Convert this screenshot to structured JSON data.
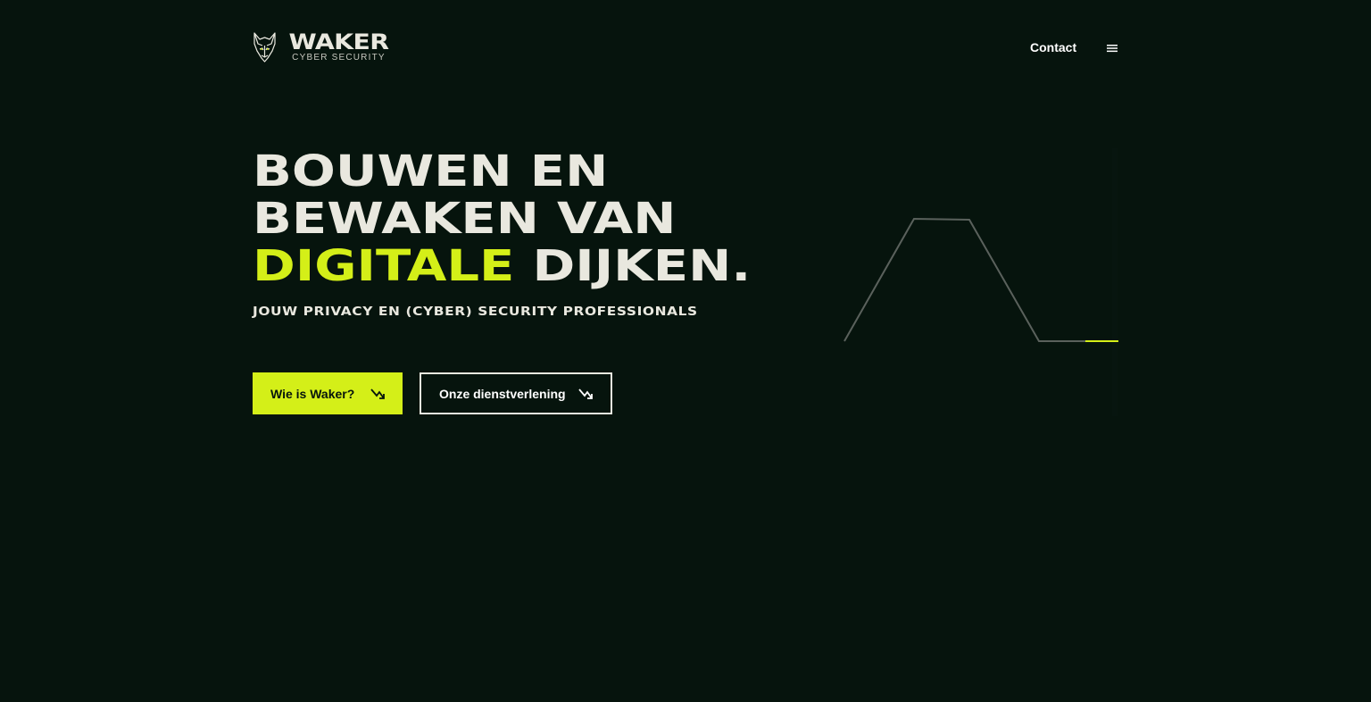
{
  "header": {
    "logo": {
      "word": "WAKER",
      "subtitle": "CYBER SECURITY"
    },
    "nav": {
      "contact_label": "Contact",
      "menu_icon": "hamburger-icon"
    }
  },
  "hero": {
    "headline_line1": "BOUWEN EN",
    "headline_line2": "BEWAKEN VAN",
    "headline_line3_accent": "DIGITALE",
    "headline_line3_rest": " DIJKEN.",
    "subheadline": "JOUW PRIVACY EN (CYBER) SECURITY PROFESSIONALS",
    "primary_button": {
      "label": "Wie is Waker?",
      "icon": "arrow-up-right-icon"
    },
    "secondary_button": {
      "label": "Onze dienstverlening",
      "icon": "arrow-up-right-icon"
    }
  },
  "colors": {
    "background": "#06140d",
    "accent": "#d4ef18",
    "text": "#e9e8df",
    "graphic_line": "#5a615c"
  }
}
